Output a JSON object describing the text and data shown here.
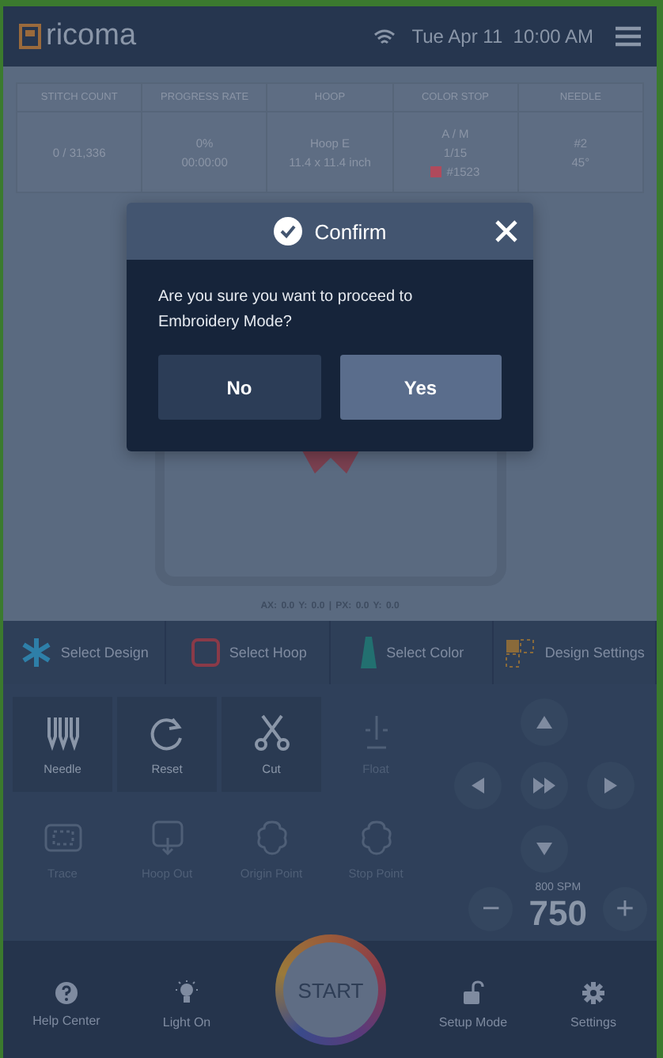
{
  "header": {
    "logo": "ricoma",
    "datetime": "Tue Apr 11  10:00 AM"
  },
  "stats": [
    {
      "label": "STITCH COUNT",
      "lines": [
        {
          "text": "0 / 31,336"
        }
      ]
    },
    {
      "label": "PROGRESS RATE",
      "lines": [
        {
          "text": "0%"
        },
        {
          "text": "00:00:00"
        }
      ]
    },
    {
      "label": "HOOP",
      "lines": [
        {
          "text": "Hoop E"
        },
        {
          "text": "11.4 x 11.4 inch"
        }
      ]
    },
    {
      "label": "COLOR STOP",
      "lines": [
        {
          "text": "A / M"
        },
        {
          "text": "1/15"
        },
        {
          "text": "#1523",
          "color": "#b04a5c"
        }
      ]
    },
    {
      "label": "NEEDLE",
      "lines": [
        {
          "text": "#2"
        },
        {
          "text": "45°"
        }
      ]
    }
  ],
  "design": {
    "coordinates": "AX: 0.0 Y: 0.0  |  PX: 0.0 Y: 0.0"
  },
  "toolbar": [
    {
      "label": "Select Design",
      "kind": "design"
    },
    {
      "label": "Select Hoop",
      "kind": "hoop"
    },
    {
      "label": "Select Color",
      "kind": "color"
    },
    {
      "label": "Design Settings",
      "kind": "settings"
    }
  ],
  "tools": [
    {
      "label": "Needle",
      "kind": "needle",
      "disabled": false
    },
    {
      "label": "Reset",
      "kind": "reset",
      "disabled": false
    },
    {
      "label": "Cut",
      "kind": "cut",
      "disabled": false
    },
    {
      "label": "Float",
      "kind": "float",
      "disabled": true
    },
    {
      "label": "Trace",
      "kind": "trace",
      "disabled": true
    },
    {
      "label": "Hoop Out",
      "kind": "hoopout",
      "disabled": true
    },
    {
      "label": "Origin Point",
      "kind": "origin",
      "disabled": true
    },
    {
      "label": "Stop Point",
      "kind": "stop",
      "disabled": true
    }
  ],
  "speed": {
    "max": "800 SPM",
    "value": "750",
    "minus": "−",
    "plus": "+"
  },
  "start": {
    "label": "START"
  },
  "bottom_nav": [
    {
      "label": "Help Center",
      "kind": "help"
    },
    {
      "label": "Light On",
      "kind": "light"
    },
    {
      "label": "Setup Mode",
      "kind": "lock"
    },
    {
      "label": "Settings",
      "kind": "gear"
    }
  ],
  "dialog": {
    "title": "Confirm",
    "message": "Are you sure you want to proceed to Embroidery Mode?",
    "buttons": [
      {
        "label": "No",
        "primary": false
      },
      {
        "label": "Yes",
        "primary": true
      }
    ]
  }
}
